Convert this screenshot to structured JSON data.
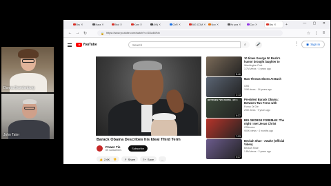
{
  "participants": [
    {
      "name": "Donna Brandenburg"
    },
    {
      "name": "John Tater"
    }
  ],
  "browser": {
    "tabs": [
      {
        "label": "Bru",
        "color": "#d93025",
        "active": false
      },
      {
        "label": "Nara",
        "color": "#555555",
        "active": false
      },
      {
        "label": "Brol",
        "color": "#d93025",
        "active": false
      },
      {
        "label": "Kom",
        "color": "#d93025",
        "active": false
      },
      {
        "label": "(99)",
        "color": "#444444",
        "active": false
      },
      {
        "label": "ChR",
        "color": "#1a73e8",
        "active": false
      },
      {
        "label": "BIG COM",
        "color": "#d93025",
        "active": false
      },
      {
        "label": "Nov",
        "color": "#e8710a",
        "active": false
      },
      {
        "label": "Nr yea",
        "color": "#555555",
        "active": false
      },
      {
        "label": "Cov",
        "color": "#9334e6",
        "active": false
      },
      {
        "label": "Bru",
        "color": "#d93025",
        "active": true
      }
    ],
    "url": "https://www.youtube.com/watch?v=GDa4WNn",
    "window_controls": "— ▢ ✕"
  },
  "youtube": {
    "search_placeholder": "Search",
    "signin_label": "Sign in",
    "video": {
      "title": "Barack Obama Describes his Ideal Third Term",
      "channel": "Power Tie",
      "subscribers": "8K subscribers",
      "subscribe_label": "Subscribe",
      "likes": "2.6K",
      "share_label": "Share",
      "save_label": "Save",
      "more_label": "..."
    },
    "recommendations": [
      {
        "title": "10 times George W. Bush's humor brought laughter to his...",
        "channel": "Washington Post",
        "meta": "3.7M views · 4 years ago",
        "duration": "8:46",
        "color": "#7a6a58"
      },
      {
        "title": "Man Throws Shoes At Bush",
        "channel": "CBS",
        "meta": "10M views · 14 years ago",
        "duration": "2:13",
        "color": "#5a6473"
      },
      {
        "title": "President Barack Obama: Between Two Ferns with Zach...",
        "channel": "Funny Or Die",
        "meta": "29M views · 9 years ago",
        "duration": "6:37",
        "color": "#3c4a3a",
        "label": "BETWEEN TWO FERNS · EP. 3"
      },
      {
        "title": "BIG GEORGE FOREMAN: The night I met Jesus Christ",
        "channel": "CBNvoice",
        "meta": "900K views · 4 months ago",
        "duration": "7:33",
        "color": "#b7342a"
      },
      {
        "title": "Beckah Shae - Awake (Official Video)",
        "channel": "Beckah Shae",
        "meta": "1.8M views · 2 years ago",
        "duration": "4:27",
        "color": "#6b5b8c"
      }
    ]
  },
  "colors": {
    "accent": "#ff0000",
    "link": "#065fd4"
  }
}
